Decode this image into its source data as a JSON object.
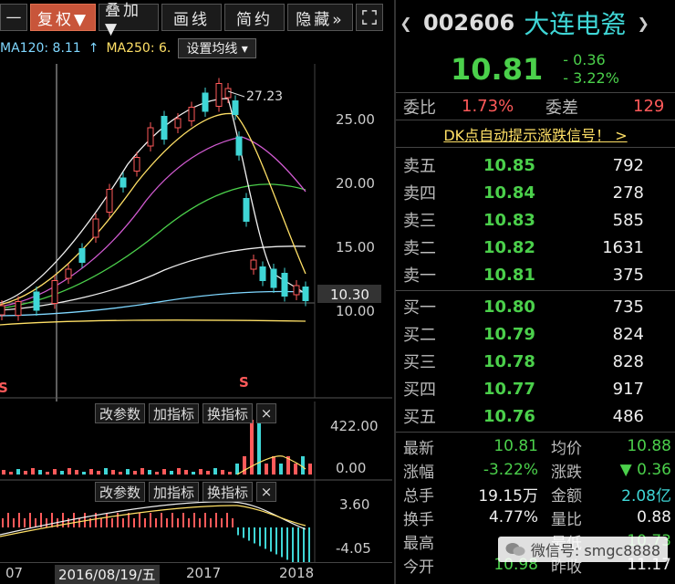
{
  "toolbar": {
    "minus": "—",
    "fuquan": "复权▼",
    "diejia": "叠加▼",
    "huaxian": "画线",
    "jianyue": "简约",
    "yincang": "隐藏»",
    "fullscreen_icon": "fullscreen-icon"
  },
  "ma_bar": {
    "ma120": "MA120: 8.11",
    "ma250": "MA250: 6.",
    "settings": "设置均线 ▾"
  },
  "main_chart": {
    "peak_label": "27.23",
    "price_ticks": [
      "25.00",
      "20.00",
      "15.00",
      "10.00"
    ],
    "current_price_tag": "10.30",
    "signal_marks": [
      "S",
      "S"
    ]
  },
  "vol_panel": {
    "btn_params": "改参数",
    "btn_add": "加指标",
    "btn_swap": "换指标",
    "close": "×",
    "ticks": [
      "422.00",
      "0.00"
    ]
  },
  "macd_panel": {
    "btn_params": "改参数",
    "btn_add": "加指标",
    "btn_swap": "换指标",
    "close": "×",
    "ticks": [
      "3.60",
      "-4.05"
    ]
  },
  "date_axis": {
    "left": "07",
    "cursor": "2016/08/19/五",
    "y2017": "2017",
    "y2018": "2018"
  },
  "quote": {
    "code": "002606",
    "name": "大连电瓷",
    "price": "10.81",
    "change": "- 0.36",
    "change_pct": "- 3.22%",
    "weibi_label": "委比",
    "weibi": "1.73%",
    "weicha_label": "委差",
    "weicha": "129",
    "dk_signal": "DK点自动提示涨跌信号！ >",
    "asks": [
      {
        "label": "卖五",
        "price": "10.85",
        "vol": "792"
      },
      {
        "label": "卖四",
        "price": "10.84",
        "vol": "278"
      },
      {
        "label": "卖三",
        "price": "10.83",
        "vol": "585"
      },
      {
        "label": "卖二",
        "price": "10.82",
        "vol": "1631"
      },
      {
        "label": "卖一",
        "price": "10.81",
        "vol": "375"
      }
    ],
    "bids": [
      {
        "label": "买一",
        "price": "10.80",
        "vol": "735"
      },
      {
        "label": "买二",
        "price": "10.79",
        "vol": "824"
      },
      {
        "label": "买三",
        "price": "10.78",
        "vol": "828"
      },
      {
        "label": "买四",
        "price": "10.77",
        "vol": "917"
      },
      {
        "label": "买五",
        "price": "10.76",
        "vol": "486"
      }
    ],
    "stats": [
      {
        "l1": "最新",
        "v1": "10.81",
        "l2": "均价",
        "v2": "10.88"
      },
      {
        "l1": "涨幅",
        "v1": "-3.22%",
        "l2": "涨跌",
        "v2": "▼ 0.36"
      },
      {
        "l1": "总手",
        "v1": "19.15万",
        "l2": "金额",
        "v2": "2.08亿"
      },
      {
        "l1": "换手",
        "v1": "4.77%",
        "l2": "量比",
        "v2": "0.88"
      },
      {
        "l1": "最高",
        "v1": "",
        "l2": "最低",
        "v2": "10.73"
      },
      {
        "l1": "今开",
        "v1": "10.98",
        "l2": "昨收",
        "v2": "11.17"
      }
    ],
    "watermark": "微信号: smgc8888"
  }
}
